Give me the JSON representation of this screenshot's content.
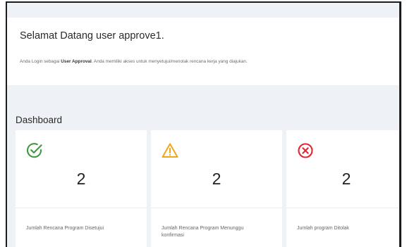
{
  "welcome": {
    "title": "Selamat Datang user approve1.",
    "desc_before": "Anda Login sebagai ",
    "desc_role": "User Approval",
    "desc_after": ". Anda memiliki akses untuk menyetujui/menolak rencana kerja yang diajukan."
  },
  "dashboard": {
    "title": "Dashboard",
    "cards": [
      {
        "icon": "check-circle-icon",
        "value": "2",
        "label": "Jumlah Rencana Program Disetujui",
        "color": "#3c9a3c"
      },
      {
        "icon": "warning-triangle-icon",
        "value": "2",
        "label": "Jumlah Rencana Program Menunggu konfirmasi",
        "color": "#f2a51a"
      },
      {
        "icon": "x-circle-icon",
        "value": "2",
        "label": "Jumlah program Ditolak",
        "color": "#e3262f"
      }
    ]
  }
}
